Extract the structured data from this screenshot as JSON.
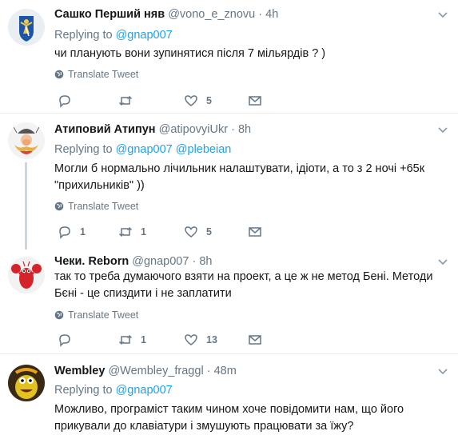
{
  "tweets": [
    {
      "name": "Сашко Перший няв",
      "handle": "@vono_e_znovu",
      "dot": "·",
      "time": "4h",
      "replying_label": "Replying to",
      "mentions": [
        "@gnap007"
      ],
      "text": "чи планують вони зупинятися після 7 мільярдів ? )",
      "translate": "Translate Tweet",
      "reply_count": "",
      "retweet_count": "",
      "like_count": "5",
      "avatar_icon": "coat-of-arms-angel"
    },
    {
      "name": "Атиповий Атипун",
      "handle": "@atipovyiUkr",
      "dot": "·",
      "time": "8h",
      "replying_label": "Replying to",
      "mentions": [
        "@gnap007",
        "@plebeian"
      ],
      "text": "Могли б нормально лічильник налаштувати, ідіоти, а то з 2 ночі +65к \"прихильників\" ))",
      "translate": "Translate Tweet",
      "reply_count": "1",
      "retweet_count": "1",
      "like_count": "5",
      "avatar_icon": "cartoon-gaul"
    },
    {
      "name": "Чеки. Reborn",
      "handle": "@gnap007",
      "dot": "·",
      "time": "8h",
      "text": "так то треба думаючого взяти на проект, а це ж не метод Бені. Методи Бєні - це спиздити і не заплатити",
      "translate": "Translate Tweet",
      "reply_count": "",
      "retweet_count": "1",
      "like_count": "13",
      "avatar_icon": "red-lobster"
    },
    {
      "name": "Wembley",
      "handle": "@Wembley_fraggl",
      "dot": "·",
      "time": "48m",
      "replying_label": "Replying to",
      "mentions": [
        "@gnap007"
      ],
      "text": "Можливо, програміст таким чином хоче повідомити нам, що його прикували до клавіатури і змушують працювати за їжу?",
      "avatar_icon": "yellow-fraggle"
    }
  ],
  "colors": {
    "accent": "#1da1f2",
    "secondary_text": "#657786",
    "separator": "#e6ecf0",
    "thread_line": "#ccd6dd"
  }
}
